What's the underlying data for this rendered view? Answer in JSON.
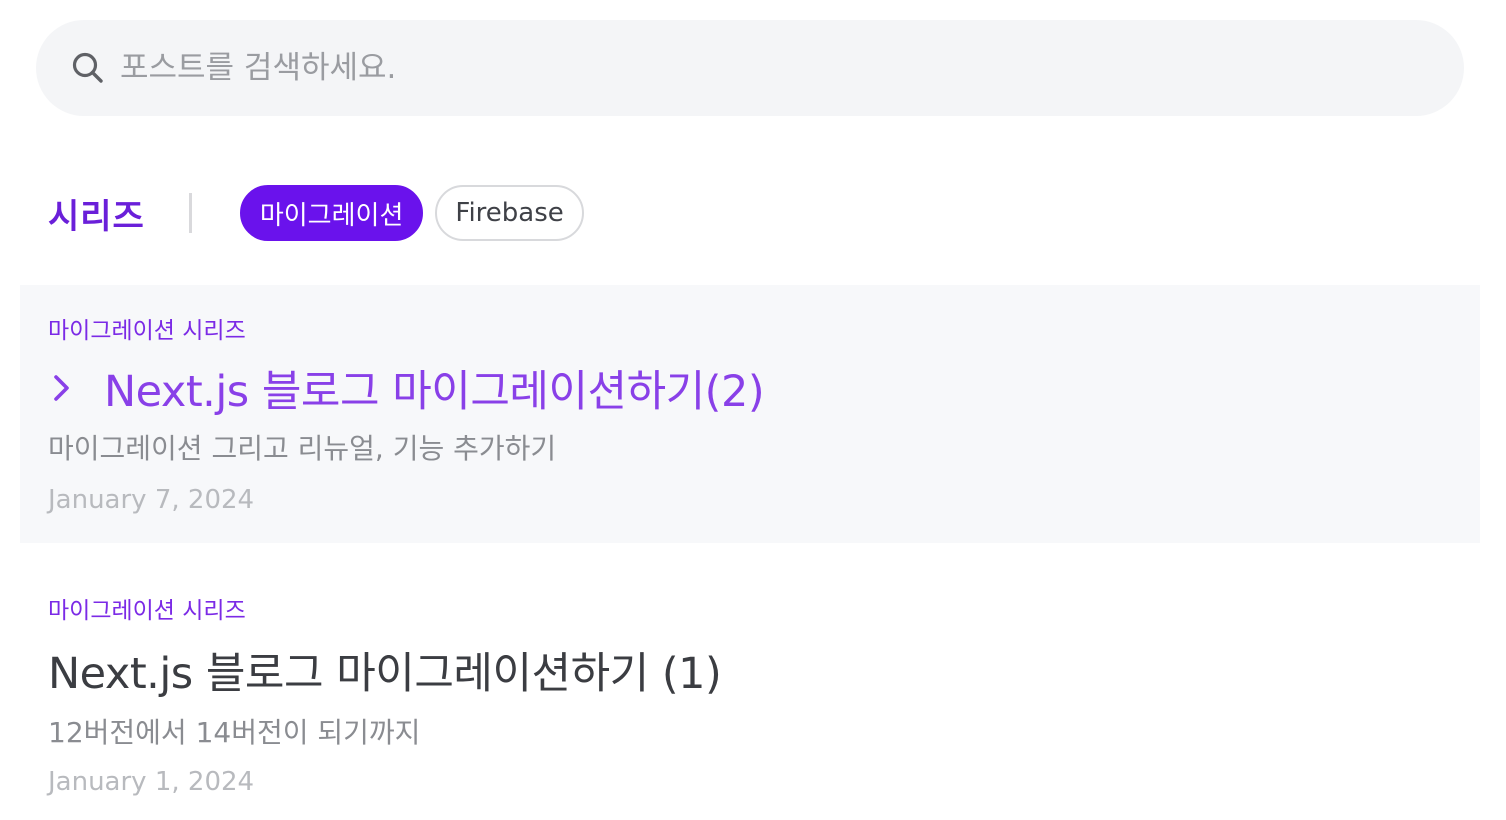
{
  "search": {
    "placeholder": "포스트를 검색하세요.",
    "value": ""
  },
  "series": {
    "label": "시리즈",
    "chips": [
      {
        "label": "마이그레이션",
        "active": true
      },
      {
        "label": "Firebase",
        "active": false
      }
    ]
  },
  "posts": [
    {
      "series": "마이그레이션 시리즈",
      "title": "Next.js 블로그 마이그레이션하기(2)",
      "description": "마이그레이션 그리고 리뉴얼, 기능 추가하기",
      "date": "January 7, 2024",
      "highlighted": true
    },
    {
      "series": "마이그레이션 시리즈",
      "title": "Next.js 블로그 마이그레이션하기 (1)",
      "description": "12버전에서 14버전이 되기까지",
      "date": "January 1, 2024",
      "highlighted": false
    }
  ],
  "colors": {
    "accent": "#6a12ec",
    "highlight_title": "#8940e8",
    "highlight_bg": "#f7f8fa"
  },
  "icons": {
    "search": "search-icon",
    "chevron": "chevron-right-icon"
  }
}
